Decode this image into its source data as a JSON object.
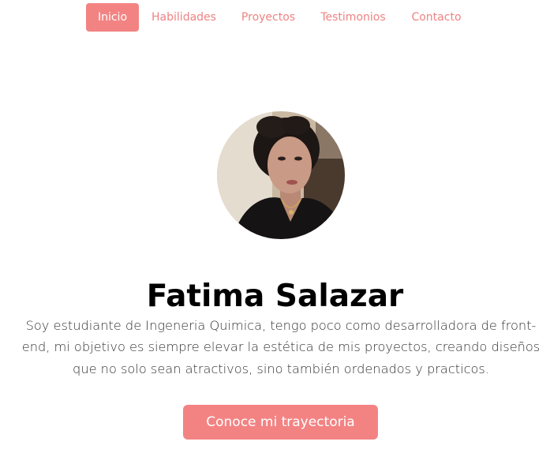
{
  "nav": {
    "items": [
      {
        "label": "Inicio",
        "active": true
      },
      {
        "label": "Habilidades",
        "active": false
      },
      {
        "label": "Proyectos",
        "active": false
      },
      {
        "label": "Testimonios",
        "active": false
      },
      {
        "label": "Contacto",
        "active": false
      }
    ]
  },
  "hero": {
    "name": "Fatima Salazar",
    "bio": "Soy estudiante de Ingeneria Quimica, tengo poco como desarrolladora de front-end, mi objetivo es siempre elevar la estética de mis proyectos, creando diseños que no solo sean atractivos, sino también ordenados y practicos.",
    "cta_label": "Conoce mi trayectoria"
  },
  "colors": {
    "accent": "#f38383",
    "nav_text": "#ef8383",
    "heading": "#000000",
    "body_text": "#333333"
  }
}
